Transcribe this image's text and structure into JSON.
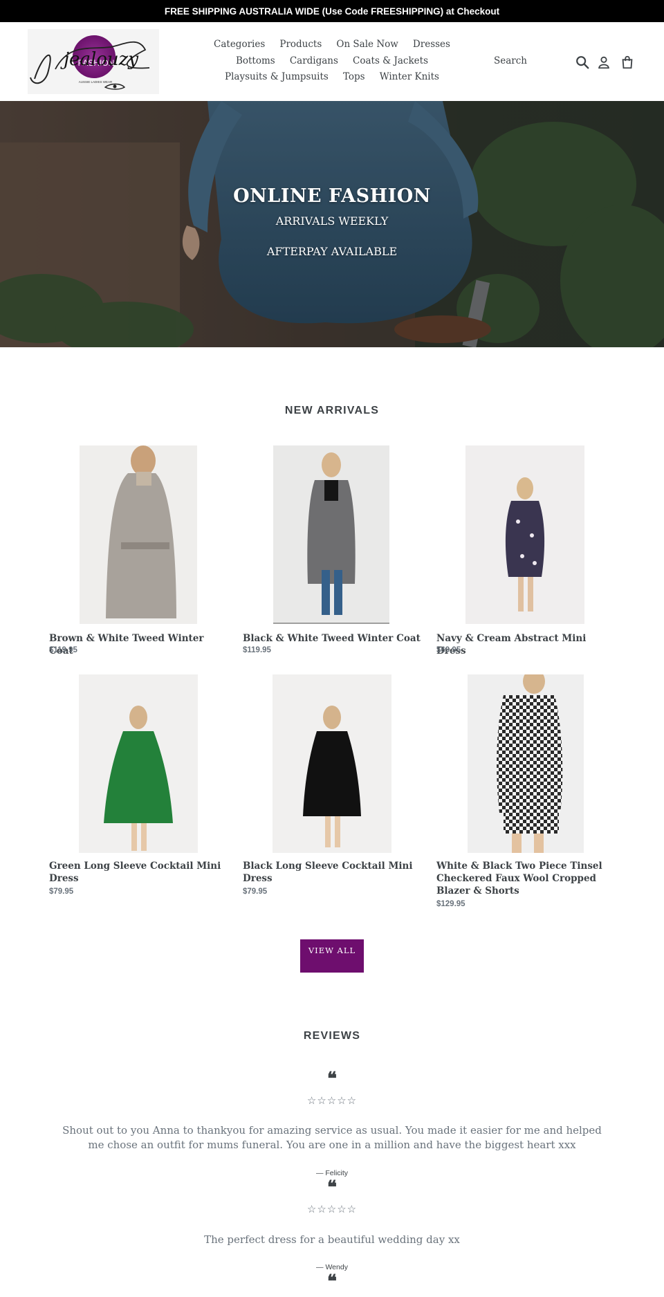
{
  "announcement": "FREE SHIPPING AUSTRALIA WIDE (Use Code FREESHIPPING) at Checkout",
  "logo": {
    "script": "jealouzy",
    "word": "FASHION",
    "tagline": "AUSSIE LADIES WEAR"
  },
  "nav": {
    "items": [
      "Categories",
      "Products",
      "On Sale Now",
      "Dresses",
      "Bottoms",
      "Cardigans",
      "Coats & Jackets",
      "Playsuits & Jumpsuits",
      "Tops",
      "Winter Knits"
    ],
    "search": "Search",
    "icons": [
      "search-icon",
      "account-icon",
      "cart-icon"
    ]
  },
  "hero": {
    "title": "ONLINE FASHION",
    "line1": "ARRIVALS WEEKLY",
    "line2": "AFTERPAY AVAILABLE"
  },
  "new_arrivals": {
    "title": "NEW ARRIVALS",
    "products": [
      {
        "title": "Brown & White Tweed Winter Coat",
        "price": "$119.95"
      },
      {
        "title": "Black & White Tweed Winter Coat",
        "price": "$119.95"
      },
      {
        "title": "Navy & Cream Abstract Mini Dress",
        "price": "$69.95"
      },
      {
        "title": "Green Long Sleeve Cocktail Mini Dress",
        "price": "$79.95"
      },
      {
        "title": "Black Long Sleeve Cocktail Mini Dress",
        "price": "$79.95"
      },
      {
        "title": "White & Black Two Piece Tinsel Checkered Faux Wool Cropped Blazer & Shorts",
        "price": "$129.95"
      }
    ],
    "view_all": "VIEW ALL"
  },
  "reviews": {
    "title": "REVIEWS",
    "quote_glyph": "❝",
    "items": [
      {
        "stars": "☆☆☆☆☆",
        "text": "Shout out to you Anna to thankyou for amazing service as usual. You made it easier for me and helped me chose an outfit for mums funeral. You are one in a million and have the biggest heart xxx",
        "author": "— Felicity"
      },
      {
        "stars": "☆☆☆☆☆",
        "text": "The perfect dress for a beautiful wedding day xx",
        "author": "— Wendy"
      }
    ]
  },
  "colors": {
    "accent": "#6e0e6e",
    "text": "#3d4246",
    "muted": "#69727b",
    "bar": "#000000"
  }
}
